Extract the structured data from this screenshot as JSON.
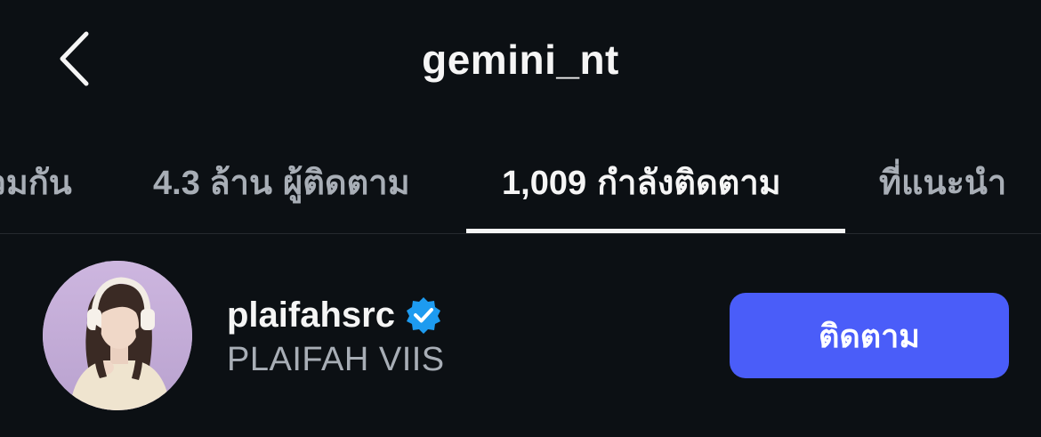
{
  "header": {
    "title": "gemini_nt",
    "back_icon": "chevron-left-icon"
  },
  "tabs": [
    {
      "label": "ร่วมกัน"
    },
    {
      "count": "4.3 ล้าน",
      "label": "ผู้ติดตาม"
    },
    {
      "count": "1,009",
      "label": "กำลังติดตาม",
      "active": true
    },
    {
      "label": "ที่แนะนำ"
    }
  ],
  "user": {
    "username": "plaifahsrc",
    "full_name": "PLAIFAH VIIS",
    "verified": true,
    "verified_icon": "verified-badge-icon",
    "follow_label": "ติดตาม"
  },
  "colors": {
    "background": "#0c1014",
    "text": "#f5f5f5",
    "muted": "#a8aeb6",
    "button": "#4a5df9",
    "verified": "#1d9bf0"
  }
}
